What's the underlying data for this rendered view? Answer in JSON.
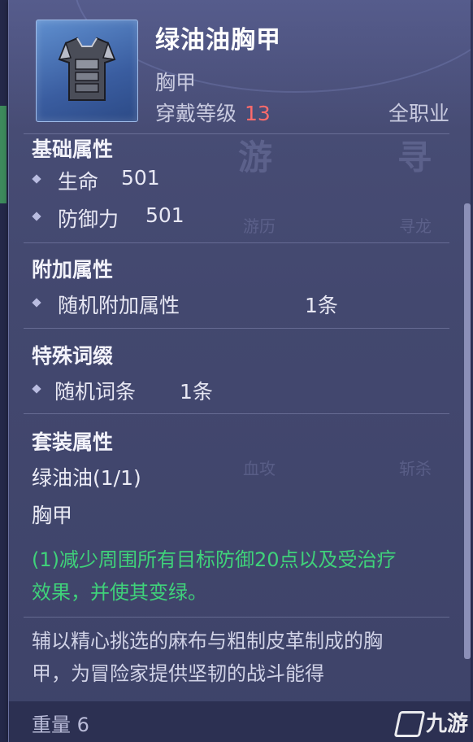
{
  "item": {
    "name": "绿油油胸甲",
    "type": "胸甲",
    "level_label": "穿戴等级",
    "level_value": "13",
    "class_req": "全职业"
  },
  "basic_attrs": {
    "title": "基础属性",
    "rows": [
      {
        "label": "生命",
        "value": "501"
      },
      {
        "label": "防御力",
        "value": "501"
      }
    ]
  },
  "extra_attrs": {
    "title": "附加属性",
    "rows": [
      {
        "label": "随机附加属性",
        "value": "1条"
      }
    ]
  },
  "special_affix": {
    "title": "特殊词缀",
    "rows": [
      {
        "label": "随机词条",
        "value": "1条"
      }
    ]
  },
  "set_attrs": {
    "title": "套装属性",
    "set_name": "绿油油(1/1)",
    "piece": "胸甲",
    "effect_line1": "(1)减少周围所有目标防御20点以及受治疗",
    "effect_line2": "效果，并使其变绿。"
  },
  "description": {
    "line1": "辅以精心挑选的麻布与粗制皮革制成的胸",
    "line2": "甲，为冒险家提供坚韧的战斗能得"
  },
  "footer": {
    "weight": "重量 6"
  },
  "watermark": "九游",
  "background_labels": {
    "big1": "游",
    "big2": "寻",
    "small1": "游历",
    "small2": "寻龙",
    "small3": "血攻",
    "small4": "斩杀"
  },
  "colors": {
    "level": "#ff6b6b",
    "set_effect": "#3fd27a"
  }
}
